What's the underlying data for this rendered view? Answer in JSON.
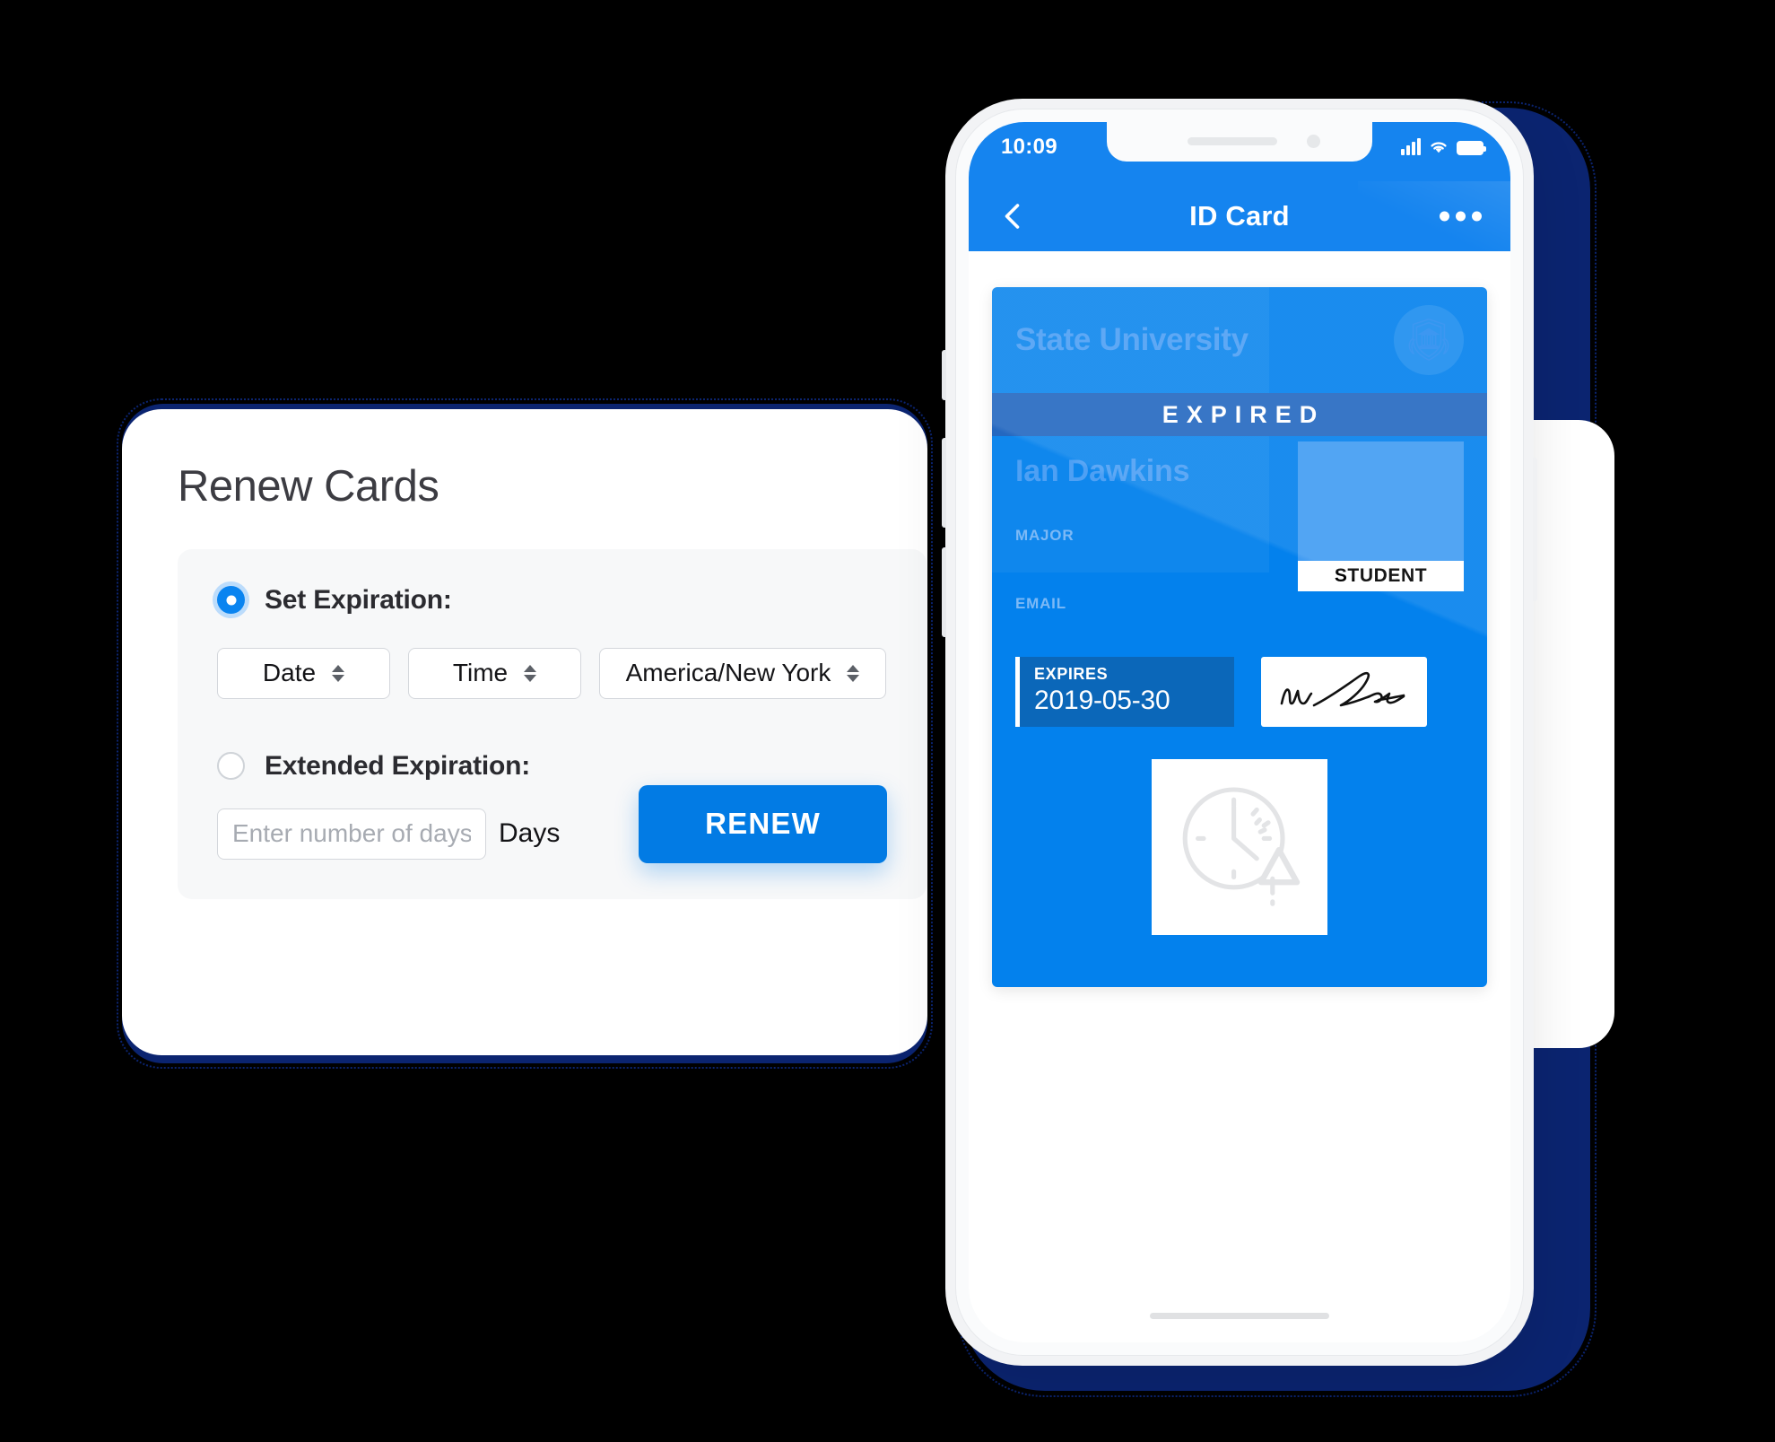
{
  "left_panel": {
    "title": "Renew Cards",
    "set_expiration": {
      "label": "Set Expiration:",
      "selected": true,
      "date_select": {
        "value": "Date",
        "options": [
          "Date"
        ]
      },
      "time_select": {
        "value": "Time",
        "options": [
          "Time"
        ]
      },
      "timezone_select": {
        "value": "America/New York",
        "options": [
          "America/New York"
        ]
      }
    },
    "extended_expiration": {
      "label": "Extended Expiration:",
      "selected": false,
      "days_input_placeholder": "Enter number of days",
      "days_input_value": "",
      "days_unit_label": "Days"
    },
    "renew_button": "RENEW"
  },
  "phone": {
    "status_bar": {
      "time": "10:09",
      "signal_icon": "cellular-bars-icon",
      "wifi_icon": "wifi-icon",
      "battery_icon": "battery-icon"
    },
    "app_bar": {
      "back_icon": "chevron-left-icon",
      "title": "ID Card",
      "more_icon": "more-horizontal-icon"
    },
    "id_card": {
      "university": "State University",
      "seal_icon": "university-seal-icon",
      "status_banner": "EXPIRED",
      "holder_name": "Ian Dawkins",
      "major_label": "MAJOR",
      "major_value": "",
      "email_label": "EMAIL",
      "email_value": "",
      "photo_icon": "photo-placeholder",
      "role_tag": "STUDENT",
      "expires_label": "EXPIRES",
      "expires_date": "2019-05-30",
      "signature_icon": "signature-icon",
      "expired_icon": "clock-warning-icon"
    },
    "home_indicator": "home-indicator"
  },
  "colors": {
    "accent_blue": "#027be4",
    "card_blue": "#0381ed",
    "header_blue": "#1584ef",
    "navy_shadow": "#0b2470",
    "expired_band": "#2468c0",
    "expires_box": "#0b67b9",
    "photo_placeholder": "#419cf2",
    "panel_bg": "#f7f8f9",
    "text_dark": "#2b2b30"
  }
}
